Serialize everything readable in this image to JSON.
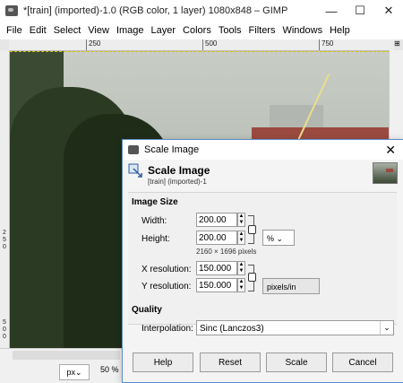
{
  "gimp": {
    "title": "*[train] (imported)-1.0 (RGB color, 1 layer) 1080x848 – GIMP",
    "menu": [
      "File",
      "Edit",
      "Select",
      "View",
      "Image",
      "Layer",
      "Colors",
      "Tools",
      "Filters",
      "Windows",
      "Help"
    ],
    "ruler_top": [
      "250",
      "500",
      "750"
    ],
    "ruler_left": [
      "2",
      "5",
      "0",
      "5",
      "0",
      "0"
    ],
    "unit": "px",
    "zoom": "50 %"
  },
  "dialog": {
    "title": "Scale Image",
    "heading": "Scale Image",
    "subheading": "[train] (imported)-1",
    "section_image_size": "Image Size",
    "width_label": "Width:",
    "width_value": "200.00",
    "height_label": "Height:",
    "height_value": "200.00",
    "size_unit": "%",
    "pixel_note": "2160 × 1696 pixels",
    "xres_label": "X resolution:",
    "xres_value": "150.000",
    "yres_label": "Y resolution:",
    "yres_value": "150.000",
    "res_unit": "pixels/in",
    "section_quality": "Quality",
    "interp_label": "Interpolation:",
    "interp_value": "Sinc (Lanczos3)",
    "buttons": {
      "help": "Help",
      "reset": "Reset",
      "scale": "Scale",
      "cancel": "Cancel"
    }
  }
}
